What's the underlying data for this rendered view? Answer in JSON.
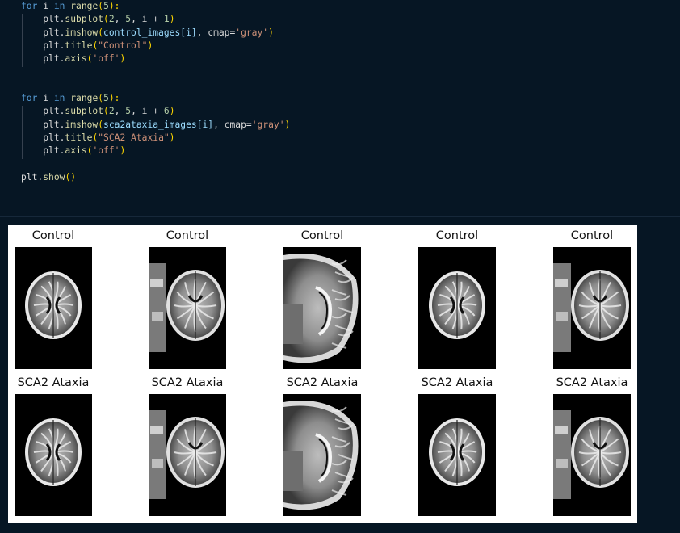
{
  "code_cell": {
    "lines_block1": [
      [
        [
          "kw",
          "for"
        ],
        [
          "tx",
          " i "
        ],
        [
          "kw",
          "in"
        ],
        [
          "tx",
          " "
        ],
        [
          "fn",
          "range"
        ],
        [
          "pun",
          "("
        ],
        [
          "num",
          "5"
        ],
        [
          "pun",
          "):"
        ]
      ],
      [
        [
          "tx",
          "    plt."
        ],
        [
          "fn",
          "subplot"
        ],
        [
          "pun",
          "("
        ],
        [
          "num",
          "2"
        ],
        [
          "tx",
          ", "
        ],
        [
          "num",
          "5"
        ],
        [
          "tx",
          ", i + "
        ],
        [
          "num",
          "1"
        ],
        [
          "pun",
          ")"
        ]
      ],
      [
        [
          "tx",
          "    plt."
        ],
        [
          "fn",
          "imshow"
        ],
        [
          "pun",
          "("
        ],
        [
          "var",
          "control_images[i]"
        ],
        [
          "tx",
          ", cmap="
        ],
        [
          "str",
          "'gray'"
        ],
        [
          "pun",
          ")"
        ]
      ],
      [
        [
          "tx",
          "    plt."
        ],
        [
          "fn",
          "title"
        ],
        [
          "pun",
          "("
        ],
        [
          "str",
          "\"Control\""
        ],
        [
          "pun",
          ")"
        ]
      ],
      [
        [
          "tx",
          "    plt."
        ],
        [
          "fn",
          "axis"
        ],
        [
          "pun",
          "("
        ],
        [
          "str",
          "'off'"
        ],
        [
          "pun",
          ")"
        ]
      ]
    ],
    "lines_block2": [
      [
        [
          "kw",
          "for"
        ],
        [
          "tx",
          " i "
        ],
        [
          "kw",
          "in"
        ],
        [
          "tx",
          " "
        ],
        [
          "fn",
          "range"
        ],
        [
          "pun",
          "("
        ],
        [
          "num",
          "5"
        ],
        [
          "pun",
          "):"
        ]
      ],
      [
        [
          "tx",
          "    plt."
        ],
        [
          "fn",
          "subplot"
        ],
        [
          "pun",
          "("
        ],
        [
          "num",
          "2"
        ],
        [
          "tx",
          ", "
        ],
        [
          "num",
          "5"
        ],
        [
          "tx",
          ", i + "
        ],
        [
          "num",
          "6"
        ],
        [
          "pun",
          ")"
        ]
      ],
      [
        [
          "tx",
          "    plt."
        ],
        [
          "fn",
          "imshow"
        ],
        [
          "pun",
          "("
        ],
        [
          "var",
          "sca2ataxia_images[i]"
        ],
        [
          "tx",
          ", cmap="
        ],
        [
          "str",
          "'gray'"
        ],
        [
          "pun",
          ")"
        ]
      ],
      [
        [
          "tx",
          "    plt."
        ],
        [
          "fn",
          "title"
        ],
        [
          "pun",
          "("
        ],
        [
          "str",
          "\"SCA2 Ataxia\""
        ],
        [
          "pun",
          ")"
        ]
      ],
      [
        [
          "tx",
          "    plt."
        ],
        [
          "fn",
          "axis"
        ],
        [
          "pun",
          "("
        ],
        [
          "str",
          "'off'"
        ],
        [
          "pun",
          ")"
        ]
      ]
    ],
    "lines_block3": [
      [
        [
          "tx",
          "plt."
        ],
        [
          "fn",
          "show"
        ],
        [
          "pun",
          "()"
        ]
      ]
    ]
  },
  "output": {
    "row1_titles": [
      "Control",
      "Control",
      "Control",
      "Control",
      "Control"
    ],
    "row2_titles": [
      "SCA2 Ataxia",
      "SCA2 Ataxia",
      "SCA2 Ataxia",
      "SCA2 Ataxia",
      "SCA2 Ataxia"
    ]
  }
}
